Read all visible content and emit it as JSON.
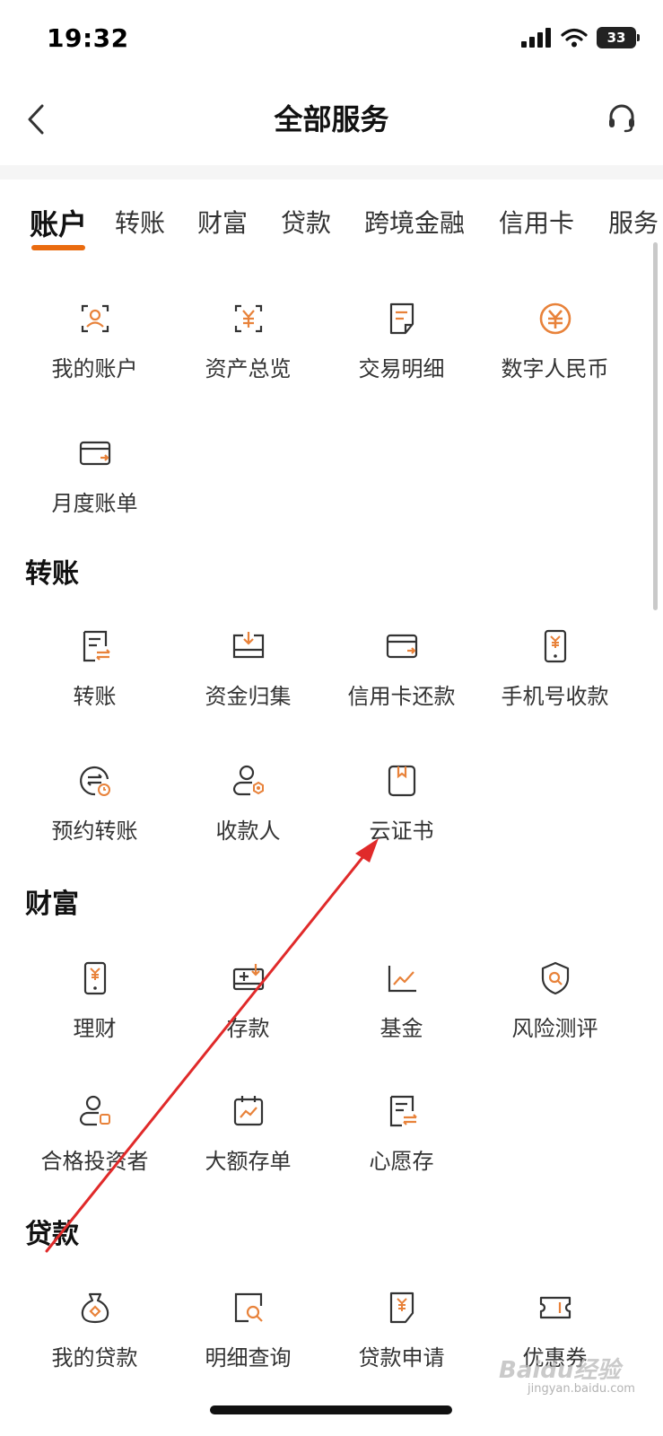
{
  "status_bar": {
    "time": "19:32",
    "battery": "33"
  },
  "header": {
    "title": "全部服务"
  },
  "tabs": [
    {
      "label": "账户",
      "active": true
    },
    {
      "label": "转账",
      "active": false
    },
    {
      "label": "财富",
      "active": false
    },
    {
      "label": "贷款",
      "active": false
    },
    {
      "label": "跨境金融",
      "active": false
    },
    {
      "label": "信用卡",
      "active": false
    },
    {
      "label": "服务",
      "active": false
    }
  ],
  "sections": {
    "account": {
      "items": [
        {
          "label": "我的账户",
          "icon": "user-frame-icon"
        },
        {
          "label": "资产总览",
          "icon": "yuan-frame-icon"
        },
        {
          "label": "交易明细",
          "icon": "document-icon"
        },
        {
          "label": "数字人民币",
          "icon": "digital-rmb-icon"
        },
        {
          "label": "月度账单",
          "icon": "card-bill-icon"
        }
      ]
    },
    "transfer": {
      "title": "转账",
      "items": [
        {
          "label": "转账",
          "icon": "transfer-doc-icon"
        },
        {
          "label": "资金归集",
          "icon": "fund-collect-icon"
        },
        {
          "label": "信用卡还款",
          "icon": "credit-card-icon"
        },
        {
          "label": "手机号收款",
          "icon": "phone-yuan-icon"
        },
        {
          "label": "预约转账",
          "icon": "scheduled-transfer-icon"
        },
        {
          "label": "收款人",
          "icon": "payee-icon"
        },
        {
          "label": "云证书",
          "icon": "certificate-icon"
        }
      ]
    },
    "wealth": {
      "title": "财富",
      "items": [
        {
          "label": "理财",
          "icon": "phone-yuan-icon"
        },
        {
          "label": "存款",
          "icon": "deposit-icon"
        },
        {
          "label": "基金",
          "icon": "chart-line-icon"
        },
        {
          "label": "风险测评",
          "icon": "shield-search-icon"
        },
        {
          "label": "合格投资者",
          "icon": "investor-icon"
        },
        {
          "label": "大额存单",
          "icon": "calendar-chart-icon"
        },
        {
          "label": "心愿存",
          "icon": "wish-deposit-icon"
        }
      ]
    },
    "loan": {
      "title": "贷款",
      "items": [
        {
          "label": "我的贷款",
          "icon": "money-bag-icon"
        },
        {
          "label": "明细查询",
          "icon": "search-doc-icon"
        },
        {
          "label": "贷款申请",
          "icon": "loan-apply-icon"
        },
        {
          "label": "优惠券",
          "icon": "coupon-icon"
        }
      ]
    }
  },
  "watermark": {
    "text": "Baidu经验",
    "sub": "jingyan.baidu.com"
  },
  "colors": {
    "accent": "#ea6b0f",
    "icon_stroke": "#333333",
    "annotation_arrow": "#e02a2a"
  }
}
